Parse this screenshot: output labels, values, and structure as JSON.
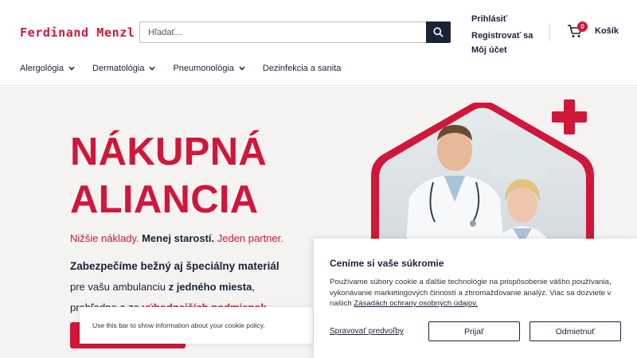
{
  "header": {
    "logo": "Ferdinand Menzl",
    "search_placeholder": "Hľadať...",
    "login": "Prihlásiť",
    "register": "Registrovať sa",
    "my_account": "Môj účet",
    "cart_count": "0",
    "cart_label": "Košík"
  },
  "nav": {
    "items": [
      {
        "label": "Alergológia",
        "dropdown": true
      },
      {
        "label": "Dermatológia",
        "dropdown": true
      },
      {
        "label": "Pneumonológia",
        "dropdown": true
      },
      {
        "label": "Dezinfekcia a sanita",
        "dropdown": false
      }
    ]
  },
  "hero": {
    "headline_line1": "NÁKUPNÁ",
    "headline_line2": "ALIANCIA",
    "tagline_a": "Nižšie náklady.",
    "tagline_b": "Menej starostí.",
    "tagline_c": "Jeden partner.",
    "copy_line1": "Zabezpečíme bežný aj špeciálny materiál",
    "copy_line2_a": "pre vašu ambulanciu ",
    "copy_line2_b": "z jedného miesta",
    "copy_line2_c": ",",
    "copy_line3_a": "prehľadne a za ",
    "copy_line3_b": "výhodnejších podmienok",
    "copy_line3_c": "."
  },
  "cookie_bar": {
    "text": "Use this bar to show information about your cookie policy."
  },
  "consent": {
    "title": "Ceníme si vaše súkromie",
    "text": "Používame súbory cookie a ďalšie technológie na prispôsobenie vášho používania, vykonávanie marketingových činností a zhromažďovanie analýz. Viac sa dozviete v našich ",
    "link": "Zásadách ochrany osobných údajov.",
    "manage": "Spravovať predvoľby",
    "accept": "Prijať",
    "reject": "Odmietnuť"
  },
  "colors": {
    "brand_red": "#d0173a",
    "navy": "#1a2238",
    "hero_bg": "#f4f3f2"
  }
}
